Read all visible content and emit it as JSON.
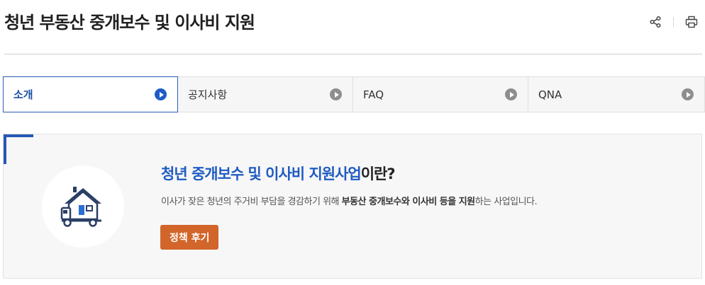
{
  "page": {
    "title": "청년 부동산 중개보수 및 이사비 지원"
  },
  "actions": {
    "share_icon": "share-icon",
    "print_icon": "print-icon"
  },
  "tabs": [
    {
      "label": "소개",
      "active": true
    },
    {
      "label": "공지사항",
      "active": false
    },
    {
      "label": "FAQ",
      "active": false
    },
    {
      "label": "QNA",
      "active": false
    }
  ],
  "intro": {
    "heading_highlight": "청년 중개보수 및 이사비 지원사업",
    "heading_rest": "이란?",
    "desc_part1": "이사가 잦은 청년의 주거비 부담을 경감하기 위해 ",
    "desc_bold": "부동산 중개보수와 이사비 등을 지원",
    "desc_part2": "하는 사업입니다.",
    "button_label": "정책 후기",
    "illustration_icon": "moving-house-icon"
  },
  "colors": {
    "accent_blue": "#1f5bc2",
    "button_orange": "#d2652a",
    "inactive_arrow": "#8e8e8e"
  }
}
